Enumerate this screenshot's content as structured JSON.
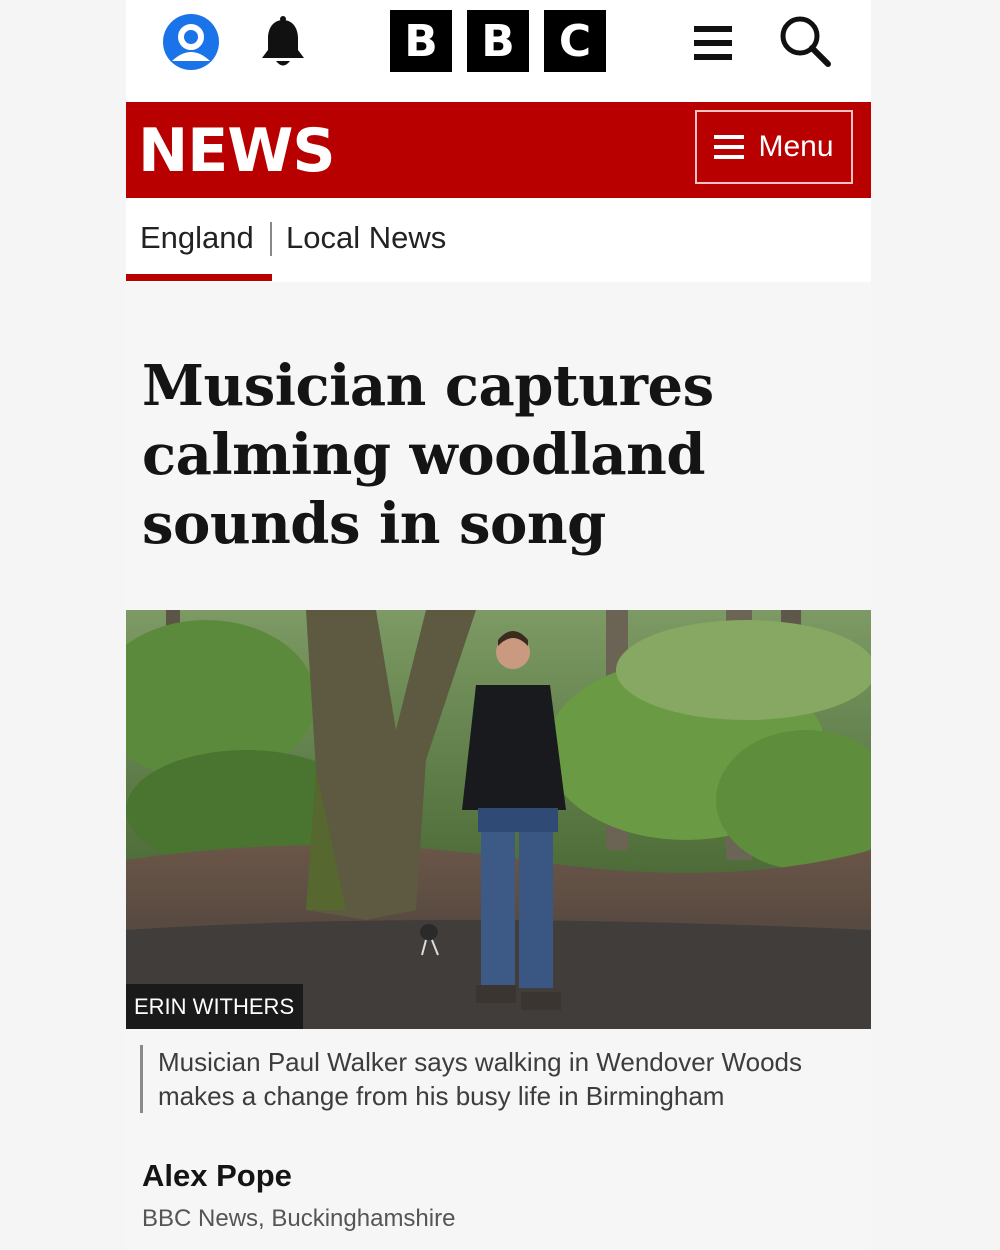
{
  "header": {
    "logo_letters": [
      "B",
      "B",
      "C"
    ],
    "icons": [
      "account-icon",
      "notification-bell-icon",
      "hamburger-menu-icon",
      "search-icon"
    ]
  },
  "news_bar": {
    "title": "NEWS",
    "menu_label": "Menu",
    "color": "#b80000"
  },
  "nav": {
    "items": [
      {
        "label": "England",
        "active": true
      },
      {
        "label": "Local News",
        "active": false
      }
    ]
  },
  "article": {
    "headline": "Musician captures calming woodland sounds in song",
    "image_credit": "ERIN WITHERS",
    "caption": "Musician Paul Walker says walking in Wendover Woods makes a change from his busy life in Birmingham",
    "author": "Alex Pope",
    "organisation": "BBC News, Buckinghamshire"
  },
  "colors": {
    "accent": "#b80000",
    "account_icon": "#1a73e8"
  }
}
